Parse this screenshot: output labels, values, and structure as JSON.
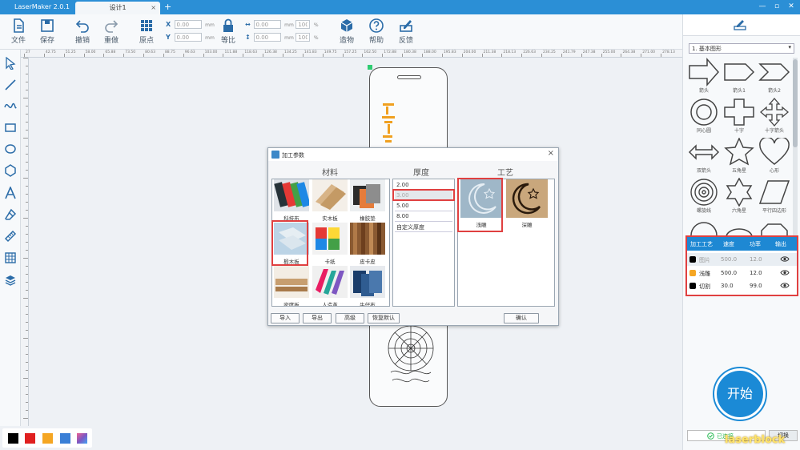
{
  "app": {
    "name": "LaserMaker 2.0.1",
    "tab": "设计1",
    "tab_close": "×",
    "new_tab": "+",
    "win_min": "—",
    "win_max": "▫",
    "win_close": "✕"
  },
  "toolbar": {
    "file": "文件",
    "save": "保存",
    "undo": "撤销",
    "redo": "重做",
    "origin": "原点",
    "lock": "等比",
    "shape_lib": "造物",
    "help": "帮助",
    "feedback": "反馈",
    "x_label": "X",
    "y_label": "Y",
    "x_value": "0.00",
    "y_value": "0.00",
    "w_value": "0.00",
    "h_value": "0.00",
    "w_pct": "100",
    "h_pct": "100",
    "unit": "mm",
    "pct_unit": "%"
  },
  "ruler": {
    "ticks": [
      "27",
      "42.75",
      "51.25",
      "58.00",
      "65.88",
      "73.50",
      "80.63",
      "88.75",
      "96.63",
      "103.00",
      "111.88",
      "118.63",
      "126.38",
      "134.25",
      "141.83",
      "149.75",
      "157.25",
      "162.50",
      "172.88",
      "180.38",
      "188.00",
      "195.83",
      "204.00",
      "211.38",
      "218.13",
      "226.63",
      "234.25",
      "241.79",
      "247.38",
      "255.00",
      "264.38",
      "271.00",
      "278.13"
    ]
  },
  "colors": {
    "accent": "#1e88d3",
    "highlight": "#e04040",
    "swatches": [
      "#000000",
      "#e02020",
      "#f5a623",
      "#3a7fd6"
    ]
  },
  "right_panel": {
    "shape_category": "1. 基本图形",
    "dropdown_arrow": "▾",
    "shapes": [
      "箭头",
      "箭头1",
      "箭头2",
      "同心圆",
      "十字",
      "十字箭头",
      "双箭头",
      "五角星",
      "心形",
      "螺旋线",
      "六角星",
      "平行四边形"
    ],
    "process_table": {
      "headers": [
        "加工工艺",
        "速度",
        "功率",
        "输出"
      ],
      "rows": [
        {
          "color": "#000000",
          "name": "图片",
          "speed": "500.0",
          "power": "12.0",
          "dim": true
        },
        {
          "color": "#f5a623",
          "name": "浅雕",
          "speed": "500.0",
          "power": "12.0",
          "dim": false
        },
        {
          "color": "#000000",
          "name": "切割",
          "speed": "30.0",
          "power": "99.0",
          "dim": false
        }
      ]
    },
    "start_label": "开始",
    "connection_status": "已连接",
    "switch_label": "切换"
  },
  "dialog": {
    "title": "加工参数",
    "close": "×",
    "materials_header": "材料",
    "thickness_header": "厚度",
    "process_header": "工艺",
    "materials": [
      "科技布",
      "实木板",
      "橡胶垫",
      "椴木板",
      "卡纸",
      "皮卡皮",
      "密度板",
      "人造革",
      "牛仔布"
    ],
    "selected_material": "椴木板",
    "thicknesses": [
      "2.00",
      "3.00",
      "5.00",
      "8.00",
      "自定义厚度"
    ],
    "selected_thickness": "3.00",
    "processes": [
      "浅雕",
      "深雕"
    ],
    "selected_process": "浅雕",
    "buttons": {
      "import": "导入",
      "export": "导出",
      "advanced": "高级",
      "restore": "恢复默认",
      "confirm": "确认"
    }
  },
  "watermark": "laserblock"
}
